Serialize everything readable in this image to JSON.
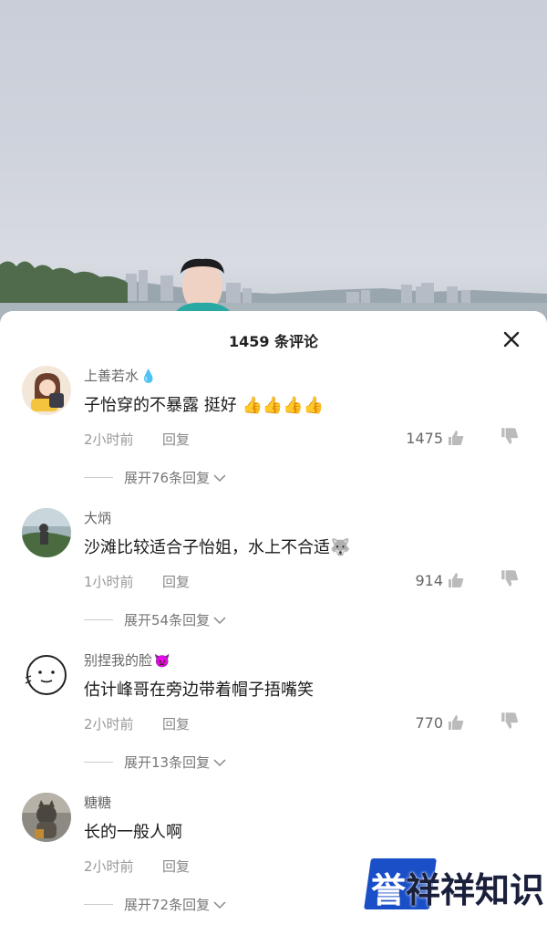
{
  "header": {
    "title": "1459 条评论"
  },
  "comments": [
    {
      "username": "上善若水",
      "username_emoji": "💧",
      "text": "子怡穿的不暴露 挺好 👍👍👍👍",
      "time": "2小时前",
      "reply": "回复",
      "likes": "1475",
      "expand": "展开76条回复"
    },
    {
      "username": "大炳",
      "username_emoji": "",
      "text": "沙滩比较适合子怡姐，水上不合适🐺",
      "time": "1小时前",
      "reply": "回复",
      "likes": "914",
      "expand": "展开54条回复"
    },
    {
      "username": "别捏我的脸",
      "username_emoji": "👿",
      "text": "估计峰哥在旁边带着帽子捂嘴笑",
      "time": "2小时前",
      "reply": "回复",
      "likes": "770",
      "expand": "展开13条回复"
    },
    {
      "username": "糖糖",
      "username_emoji": "",
      "text": "长的一般人啊",
      "time": "2小时前",
      "reply": "回复",
      "likes": "",
      "expand": "展开72条回复"
    }
  ],
  "watermark": {
    "text_a": "誉",
    "text_b": "祥祥知识"
  },
  "colors": {
    "accent": "#1a4fc8",
    "text": "#1b1b1b",
    "muted": "#999999"
  }
}
